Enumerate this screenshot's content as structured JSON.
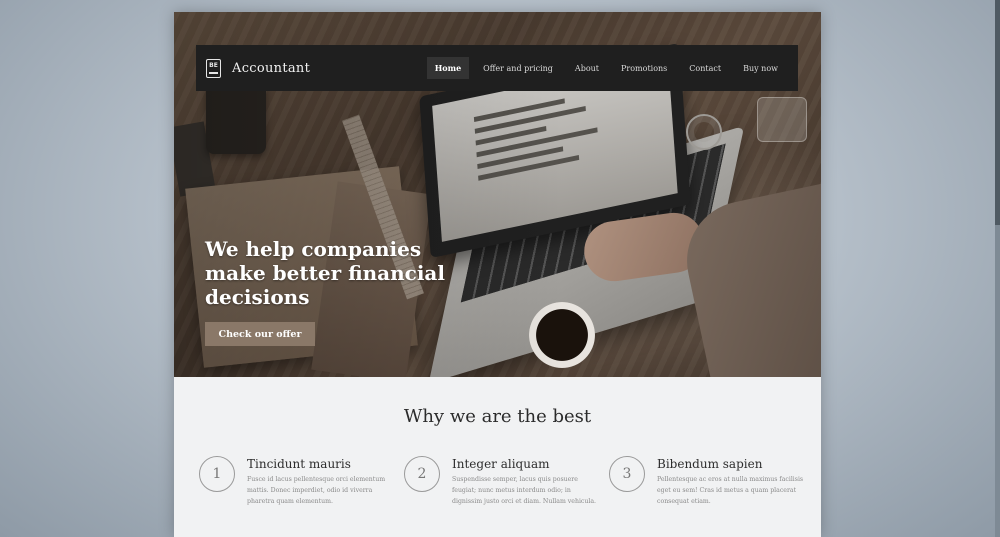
{
  "brand": {
    "logo_initials": "BE",
    "name": "Accountant"
  },
  "nav": {
    "items": [
      {
        "label": "Home",
        "active": true
      },
      {
        "label": "Offer and pricing",
        "active": false
      },
      {
        "label": "About",
        "active": false
      },
      {
        "label": "Promotions",
        "active": false
      },
      {
        "label": "Contact",
        "active": false
      },
      {
        "label": "Buy now",
        "active": false
      }
    ]
  },
  "hero": {
    "headline": "We help companies make better financial decisions",
    "cta_label": "Check our offer"
  },
  "section": {
    "title": "Why we are the best",
    "features": [
      {
        "number": "1",
        "title": "Tincidunt mauris",
        "text": "Fusce id lacus pellentesque orci elementum mattis. Donec imperdiet, odio id viverra pharetra quam elementum."
      },
      {
        "number": "2",
        "title": "Integer aliquam",
        "text": "Suspendisse semper, lacus quis posuere feugiat; nunc metus interdum odio; in dignissim justo orci et diam. Nullam vehicula."
      },
      {
        "number": "3",
        "title": "Bibendum sapien",
        "text": "Pellentesque ac eros at nulla maximus facilisis eget eu sem! Cras id metus a quam placerat consequat etiam."
      }
    ]
  },
  "colors": {
    "nav_bg": "#1f1f1f",
    "cta_bg": "#8a7868",
    "section_bg": "#f1f2f3"
  },
  "icons": {
    "logo": "book-icon"
  }
}
